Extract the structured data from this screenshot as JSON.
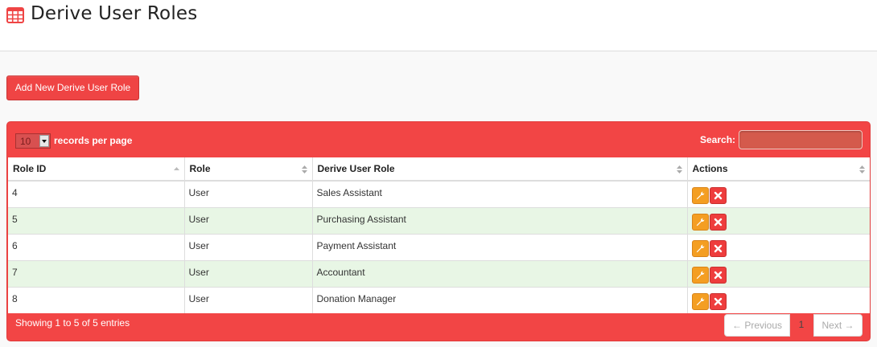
{
  "header": {
    "title": "Derive User Roles",
    "icon": "table-icon",
    "icon_color": "#ef4444"
  },
  "add_button": {
    "label": "Add New Derive User Role"
  },
  "toolbar": {
    "page_length": "10",
    "page_length_label": "records per page",
    "search_label": "Search:",
    "search_value": ""
  },
  "table": {
    "columns": [
      "Role ID",
      "Role",
      "Derive User Role",
      "Actions"
    ],
    "rows": [
      {
        "role_id": "4",
        "role": "User",
        "derive_user_role": "Sales Assistant"
      },
      {
        "role_id": "5",
        "role": "User",
        "derive_user_role": "Purchasing Assistant"
      },
      {
        "role_id": "6",
        "role": "User",
        "derive_user_role": "Payment Assistant"
      },
      {
        "role_id": "7",
        "role": "User",
        "derive_user_role": "Accountant"
      },
      {
        "role_id": "8",
        "role": "User",
        "derive_user_role": "Donation Manager"
      }
    ],
    "row_actions": [
      "wrench-icon",
      "close-icon"
    ]
  },
  "footer": {
    "info": "Showing 1 to 5 of 5 entries",
    "prev_label": "← Previous",
    "current_page": "1",
    "next_label": "Next →"
  },
  "colors": {
    "accent": "#ef4444",
    "edit_button": "#f49e22",
    "delete_button": "#ee3d3d",
    "row_stripe": "#e8f6e5"
  }
}
